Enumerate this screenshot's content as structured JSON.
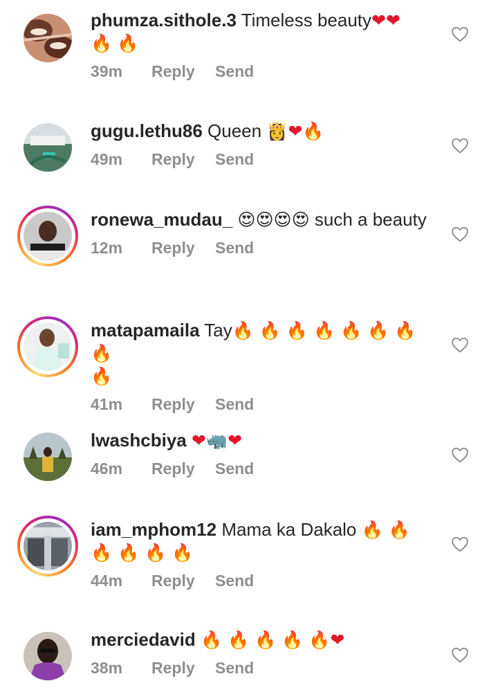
{
  "comments": [
    {
      "username": "phumza.sithole.3",
      "text": "Timeless beauty❤️❤️ 🔥🔥",
      "time": "39m",
      "reply": "Reply",
      "send": "Send",
      "story_ring": false,
      "avatar": "woman-eye-makeup-photo"
    },
    {
      "username": "gugu.lethu86",
      "text": "Queen 👸❤️🔥",
      "time": "49m",
      "reply": "Reply",
      "send": "Send",
      "story_ring": false,
      "avatar": "outdoor-photo"
    },
    {
      "username": "ronewa_mudau_",
      "text": "😍😍😍😍 such a beauty",
      "time": "12m",
      "reply": "Reply",
      "send": "Send",
      "story_ring": true,
      "avatar": "woman-portrait-photo"
    },
    {
      "username": "matapamaila",
      "text": "Tay🔥🔥🔥🔥🔥🔥🔥🔥🔥",
      "time": "41m",
      "reply": "Reply",
      "send": "Send",
      "story_ring": true,
      "avatar": "woman-seated-photo"
    },
    {
      "username": "lwashcbiya",
      "text": "❤️🦏❤️",
      "time": "46m",
      "reply": "Reply",
      "send": "Send",
      "story_ring": false,
      "avatar": "person-field-photo"
    },
    {
      "username": "iam_mphom12",
      "text": "Mama ka Dakalo 🔥🔥🔥🔥🔥🔥",
      "time": "44m",
      "reply": "Reply",
      "send": "Send",
      "story_ring": true,
      "avatar": "airplane-cabin-photo"
    },
    {
      "username": "merciedavid",
      "text": "🔥🔥🔥🔥🔥❤️",
      "time": "38m",
      "reply": "Reply",
      "send": "Send",
      "story_ring": false,
      "avatar": "woman-sunglasses-photo"
    }
  ],
  "colors": {
    "text": "#262626",
    "meta": "#8e8e8e",
    "heart": "#e0162b",
    "fire": "#ff6a00"
  },
  "icons": {
    "like": "heart-outline-icon"
  }
}
